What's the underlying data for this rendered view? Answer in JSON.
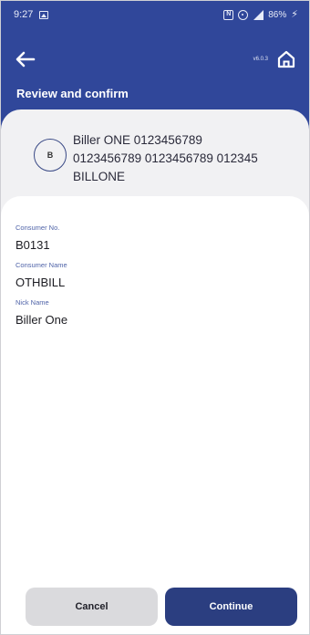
{
  "status_bar": {
    "time": "9:27",
    "battery": "86%",
    "icons": [
      "image-icon",
      "nfc-icon",
      "hotspot-icon",
      "signal-icon",
      "charging-bolt-icon"
    ]
  },
  "top_bar": {
    "back_icon": "arrow-left-icon",
    "version": "v6.0.3",
    "home_icon": "home-icon"
  },
  "page": {
    "title": "Review and confirm"
  },
  "biller": {
    "avatar_letter": "B",
    "line1": "Biller ONE 0123456789",
    "line2": "0123456789 0123456789 012345",
    "line3": "BILLONE"
  },
  "details": {
    "consumer_no_label": "Consumer No.",
    "consumer_no_value": "B0131",
    "consumer_name_label": "Consumer Name",
    "consumer_name_value": "OTHBILL",
    "nick_name_label": "Nick Name",
    "nick_name_value": "Biller One"
  },
  "actions": {
    "cancel_label": "Cancel",
    "continue_label": "Continue"
  },
  "colors": {
    "header_blue": "#30479a",
    "primary_button": "#2b3e80",
    "secondary_button": "#dadadd",
    "label_blue": "#4f63a8",
    "biller_card_bg": "#f1f1f3"
  }
}
